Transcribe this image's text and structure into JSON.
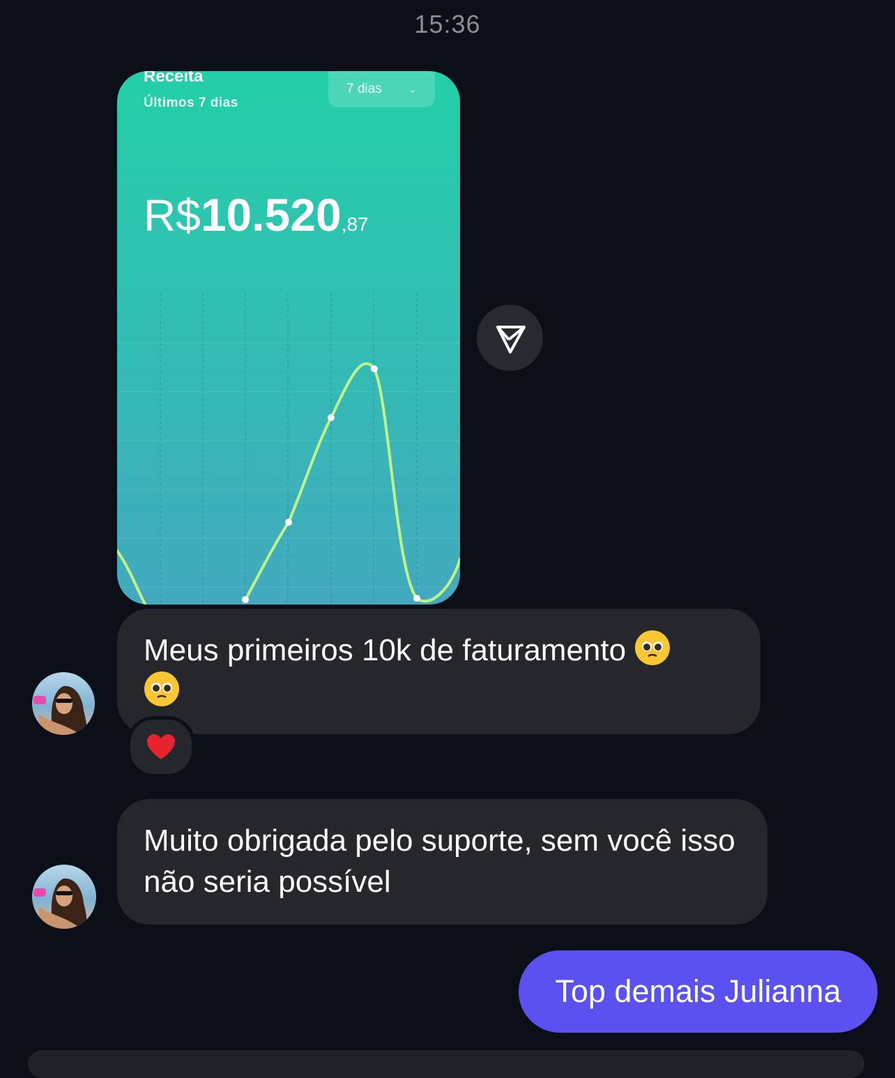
{
  "time": "15:36",
  "card": {
    "title": "Receita",
    "subtitle": "Últimos 7 dias",
    "range": "7 dias",
    "currency": "R$",
    "amount_int": "10.520",
    "amount_dec": ",87",
    "colors": {
      "top": "#23cfa7",
      "bottom": "#42a9be",
      "line": "#bff38a"
    }
  },
  "chart_data": {
    "type": "line",
    "points_shown": 6,
    "grid": true
  },
  "messages": [
    {
      "from": "them",
      "text": "Meus primeiros 10k de faturamento",
      "emoji": "pleading-face",
      "reaction": "heart"
    },
    {
      "from": "them",
      "text": "Muito obrigada pelo suporte, sem você isso não seria possível"
    },
    {
      "from": "me",
      "text": "Top demais Julianna"
    }
  ],
  "colors": {
    "background": "#0c0f17",
    "bubble_them": "#25272d",
    "bubble_me": "#5b50f0"
  }
}
